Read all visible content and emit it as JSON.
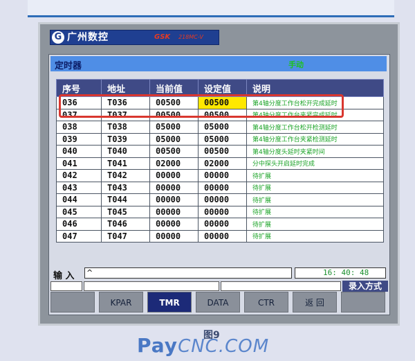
{
  "brand": {
    "logo_glyph": "G",
    "name": "广州数控",
    "gsk": "GSK",
    "model": "218MC-V"
  },
  "window": {
    "title": "定时器",
    "status": "手动"
  },
  "table": {
    "headers": [
      "序号",
      "地址",
      "当前值",
      "设定值",
      "说明"
    ],
    "rows": [
      {
        "no": "036",
        "addr": "T036",
        "cur": "00500",
        "set": "00500",
        "desc": "第4轴分度工作台松开完成延时"
      },
      {
        "no": "037",
        "addr": "T037",
        "cur": "00500",
        "set": "00500",
        "desc": "第4轴分度工作台夹紧完成延时"
      },
      {
        "no": "038",
        "addr": "T038",
        "cur": "05000",
        "set": "05000",
        "desc": "第4轴分度工作台松开检测延时"
      },
      {
        "no": "039",
        "addr": "T039",
        "cur": "05000",
        "set": "05000",
        "desc": "第4轴分度工作台夹紧检测延时"
      },
      {
        "no": "040",
        "addr": "T040",
        "cur": "00500",
        "set": "00500",
        "desc": "第4轴分度头延时夹紧时间"
      },
      {
        "no": "041",
        "addr": "T041",
        "cur": "02000",
        "set": "02000",
        "desc": "分中探头开启延时完成"
      },
      {
        "no": "042",
        "addr": "T042",
        "cur": "00000",
        "set": "00000",
        "desc": "待扩展"
      },
      {
        "no": "043",
        "addr": "T043",
        "cur": "00000",
        "set": "00000",
        "desc": "待扩展"
      },
      {
        "no": "044",
        "addr": "T044",
        "cur": "00000",
        "set": "00000",
        "desc": "待扩展"
      },
      {
        "no": "045",
        "addr": "T045",
        "cur": "00000",
        "set": "00000",
        "desc": "待扩展"
      },
      {
        "no": "046",
        "addr": "T046",
        "cur": "00000",
        "set": "00000",
        "desc": "待扩展"
      },
      {
        "no": "047",
        "addr": "T047",
        "cur": "00000",
        "set": "00000",
        "desc": "待扩展"
      }
    ]
  },
  "input": {
    "label": "输 入",
    "value": "^",
    "clock": "16: 40: 48",
    "mode": "录入方式"
  },
  "softkeys": [
    "",
    "KPAR",
    "TMR",
    "DATA",
    "CTR",
    "返 回",
    ""
  ],
  "caption": "图9",
  "watermark": {
    "pay": "Pay",
    "cnc": "CNC.COM"
  },
  "colors": {
    "highlight": "#ffe800",
    "annotation": "#d9372f",
    "desc_text": "#1aa326"
  }
}
